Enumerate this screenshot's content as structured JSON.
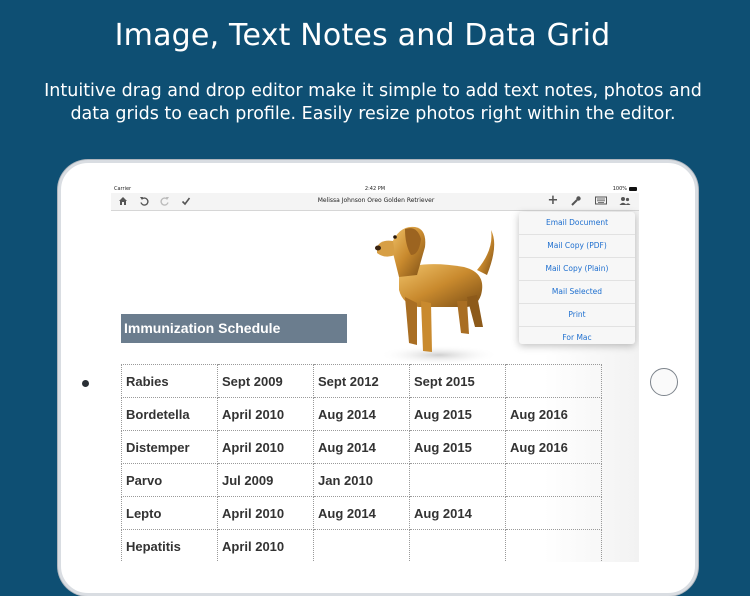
{
  "headline": "Image, Text Notes and Data Grid",
  "subline_1": "Intuitive drag and drop editor make it simple to add text notes, photos and",
  "subline_2": "data grids to each profile.  Easily resize photos right within the editor.",
  "status": {
    "carrier": "Carrier",
    "time": "2:42 PM",
    "battery": "100%"
  },
  "toolbar": {
    "title": "Melissa Johnson Oreo Golden Retriever",
    "icons": [
      "home-icon",
      "undo-icon",
      "redo-icon",
      "checkmark-icon",
      "add-icon",
      "tools-icon",
      "keyboard-icon",
      "share-contact-icon"
    ]
  },
  "section_title": "Immunization Schedule",
  "menu": {
    "items": [
      "Email Document",
      "Mail Copy (PDF)",
      "Mail Copy (Plain)",
      "Mail Selected",
      "Print",
      "For Mac"
    ]
  },
  "grid": {
    "rows": [
      [
        "Rabies",
        "Sept 2009",
        "Sept 2012",
        "Sept 2015",
        ""
      ],
      [
        "Bordetella",
        "April 2010",
        "Aug 2014",
        "Aug 2015",
        "Aug 2016"
      ],
      [
        "Distemper",
        "April 2010",
        "Aug 2014",
        "Aug 2015",
        "Aug 2016"
      ],
      [
        "Parvo",
        "Jul 2009",
        "Jan 2010",
        "",
        ""
      ],
      [
        "Lepto",
        "April 2010",
        "Aug 2014",
        "Aug 2014",
        ""
      ],
      [
        "Hepatitis",
        "April 2010",
        "",
        "",
        ""
      ]
    ]
  },
  "colors": {
    "background": "#0e4f73",
    "section_header": "#6b7d8e",
    "menu_link": "#1e6fcf"
  }
}
